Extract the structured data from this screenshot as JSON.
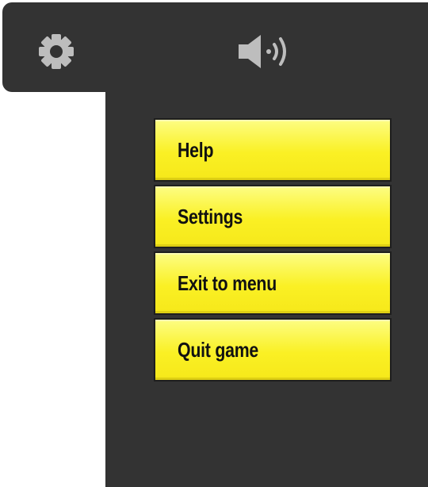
{
  "header": {
    "settings_icon": "gear-icon",
    "sound_icon": "speaker-sound-icon"
  },
  "menu": {
    "items": [
      {
        "label": "Help"
      },
      {
        "label": "Settings"
      },
      {
        "label": "Exit to menu"
      },
      {
        "label": "Quit game"
      }
    ]
  },
  "colors": {
    "panel": "#333333",
    "button_yellow": "#faf024",
    "button_text": "#111111",
    "icon_gray": "#bdbdbd",
    "background": "#ffffff"
  }
}
